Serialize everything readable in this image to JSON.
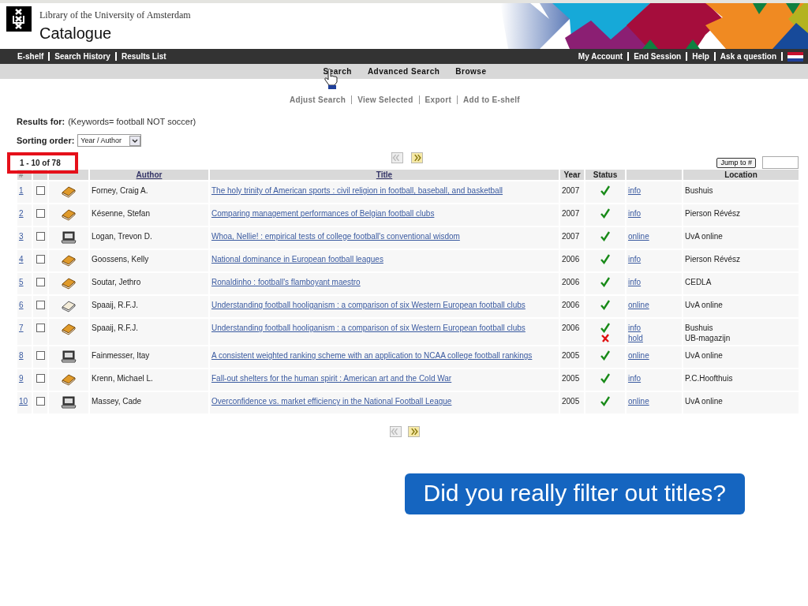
{
  "header": {
    "institution": "Library of the University of Amsterdam",
    "title": "Catalogue"
  },
  "top_nav": {
    "left": [
      "E-shelf",
      "Search History",
      "Results List"
    ],
    "right": [
      "My Account",
      "End Session",
      "Help",
      "Ask a question"
    ]
  },
  "search_tabs": [
    "Search",
    "Advanced Search",
    "Browse"
  ],
  "actions": [
    "Adjust Search",
    "View Selected",
    "Export",
    "Add to E-shelf"
  ],
  "results_for": {
    "label": "Results for:",
    "query": "(Keywords= football NOT soccer)"
  },
  "sorting": {
    "label": "Sorting order:",
    "value": "Year / Author"
  },
  "range": "1 - 10 of 78",
  "jump_button": "Jump to #",
  "table": {
    "columns": [
      "#",
      "Author",
      "Title",
      "Year",
      "Status",
      "Location"
    ],
    "rows": [
      {
        "number": "1",
        "checked": false,
        "kind": "book",
        "author": "Forney, Craig A.",
        "title": "The holy trinity of American sports : civil religion in football, baseball, and basketball",
        "year": "2007",
        "holdings": [
          {
            "available": true,
            "link": "info",
            "location": "Bushuis"
          }
        ]
      },
      {
        "number": "2",
        "checked": false,
        "kind": "book",
        "author": "Késenne, Stefan",
        "title": "Comparing management performances of Belgian football clubs",
        "year": "2007",
        "holdings": [
          {
            "available": true,
            "link": "info",
            "location": "Pierson Révész"
          }
        ]
      },
      {
        "number": "3",
        "checked": false,
        "kind": "computer",
        "author": "Logan, Trevon D.",
        "title": "Whoa, Nellie! : empirical tests of college football's conventional wisdom",
        "year": "2007",
        "holdings": [
          {
            "available": true,
            "link": "online",
            "location": "UvA online"
          }
        ]
      },
      {
        "number": "4",
        "checked": false,
        "kind": "book",
        "author": "Goossens, Kelly",
        "title": "National dominance in European football leagues",
        "year": "2006",
        "holdings": [
          {
            "available": true,
            "link": "info",
            "location": "Pierson Révész"
          }
        ]
      },
      {
        "number": "5",
        "checked": false,
        "kind": "book",
        "author": "Soutar, Jethro",
        "title": "Ronaldinho : football's flamboyant maestro",
        "year": "2006",
        "holdings": [
          {
            "available": true,
            "link": "info",
            "location": "CEDLA"
          }
        ]
      },
      {
        "number": "6",
        "checked": false,
        "kind": "pale-book",
        "author": "Spaaij, R.F.J.",
        "title": "Understanding football hooliganism : a comparison of six Western European football clubs",
        "year": "2006",
        "holdings": [
          {
            "available": true,
            "link": "online",
            "location": "UvA online"
          }
        ]
      },
      {
        "number": "7",
        "checked": false,
        "kind": "book",
        "author": "Spaaij, R.F.J.",
        "title": "Understanding football hooliganism : a comparison of six Western European football clubs",
        "year": "2006",
        "holdings": [
          {
            "available": true,
            "link": "info",
            "location": "Bushuis"
          },
          {
            "available": false,
            "link": "hold",
            "location": "UB-magazijn"
          }
        ]
      },
      {
        "number": "8",
        "checked": false,
        "kind": "computer",
        "author": "Fainmesser, Itay",
        "title": "A consistent weighted ranking scheme with an application to NCAA college football rankings",
        "year": "2005",
        "holdings": [
          {
            "available": true,
            "link": "online",
            "location": "UvA online"
          }
        ]
      },
      {
        "number": "9",
        "checked": false,
        "kind": "book",
        "author": "Krenn, Michael L.",
        "title": "Fall-out shelters for the human spirit : American art and the Cold War",
        "year": "2005",
        "holdings": [
          {
            "available": true,
            "link": "info",
            "location": "P.C.Hoofthuis"
          }
        ]
      },
      {
        "number": "10",
        "checked": false,
        "kind": "computer",
        "author": "Massey, Cade",
        "title": "Overconfidence vs. market efficiency in the National Football League",
        "year": "2005",
        "holdings": [
          {
            "available": true,
            "link": "online",
            "location": "UvA online"
          }
        ]
      }
    ]
  },
  "callout": "Did you really filter out titles?"
}
